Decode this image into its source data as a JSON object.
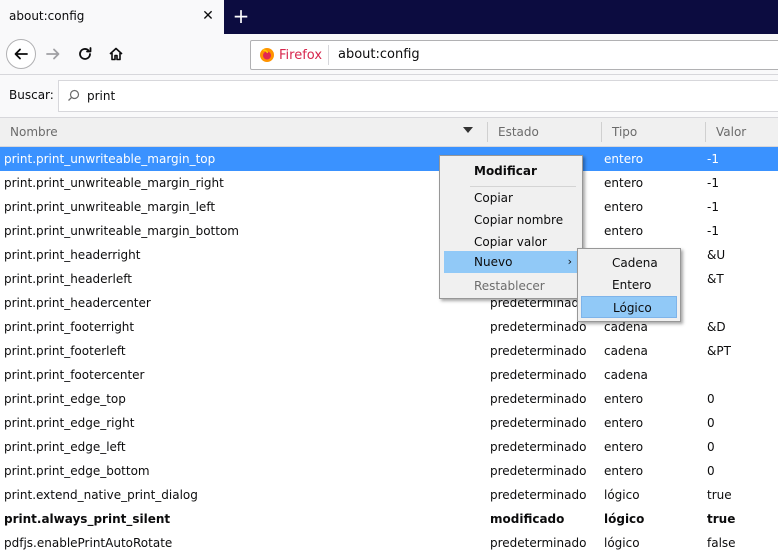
{
  "tab": {
    "title": "about:config",
    "close": "✕",
    "newtab": "+"
  },
  "urlbar": {
    "brand": "Firefox",
    "url": "about:config"
  },
  "search": {
    "label": "Buscar:",
    "value": "print"
  },
  "columns": {
    "name": "Nombre",
    "estado": "Estado",
    "tipo": "Tipo",
    "valor": "Valor"
  },
  "rows": [
    {
      "name": "print.print_unwriteable_margin_top",
      "estado": "",
      "tipo": "entero",
      "valor": "-1",
      "selected": true
    },
    {
      "name": "print.print_unwriteable_margin_right",
      "estado": "",
      "tipo": "entero",
      "valor": "-1"
    },
    {
      "name": "print.print_unwriteable_margin_left",
      "estado": "",
      "tipo": "entero",
      "valor": "-1"
    },
    {
      "name": "print.print_unwriteable_margin_bottom",
      "estado": "",
      "tipo": "entero",
      "valor": "-1"
    },
    {
      "name": "print.print_headerright",
      "estado": "",
      "tipo": "",
      "valor": "&U"
    },
    {
      "name": "print.print_headerleft",
      "estado": "",
      "tipo": "",
      "valor": "&T"
    },
    {
      "name": "print.print_headercenter",
      "estado": "predeterminado",
      "tipo": "",
      "valor": ""
    },
    {
      "name": "print.print_footerright",
      "estado": "predeterminado",
      "tipo": "cadena",
      "valor": "&D"
    },
    {
      "name": "print.print_footerleft",
      "estado": "predeterminado",
      "tipo": "cadena",
      "valor": "&PT"
    },
    {
      "name": "print.print_footercenter",
      "estado": "predeterminado",
      "tipo": "cadena",
      "valor": ""
    },
    {
      "name": "print.print_edge_top",
      "estado": "predeterminado",
      "tipo": "entero",
      "valor": "0"
    },
    {
      "name": "print.print_edge_right",
      "estado": "predeterminado",
      "tipo": "entero",
      "valor": "0"
    },
    {
      "name": "print.print_edge_left",
      "estado": "predeterminado",
      "tipo": "entero",
      "valor": "0"
    },
    {
      "name": "print.print_edge_bottom",
      "estado": "predeterminado",
      "tipo": "entero",
      "valor": "0"
    },
    {
      "name": "print.extend_native_print_dialog",
      "estado": "predeterminado",
      "tipo": "lógico",
      "valor": "true"
    },
    {
      "name": "print.always_print_silent",
      "estado": "modificado",
      "tipo": "lógico",
      "valor": "true",
      "modified": true
    },
    {
      "name": "pdfjs.enablePrintAutoRotate",
      "estado": "predeterminado",
      "tipo": "lógico",
      "valor": "false"
    }
  ],
  "context_menu": {
    "modificar": "Modificar",
    "copiar": "Copiar",
    "copiar_nombre": "Copiar nombre",
    "copiar_valor": "Copiar valor",
    "nuevo": "Nuevo",
    "restablecer": "Restablecer",
    "submenu": {
      "cadena": "Cadena",
      "entero": "Entero",
      "logico": "Lógico"
    }
  },
  "colors": {
    "tabstrip": "#0c0c40",
    "selection": "#3a92ff",
    "menu_hover": "#91c9f7",
    "firefox_brand": "#d7264d"
  }
}
